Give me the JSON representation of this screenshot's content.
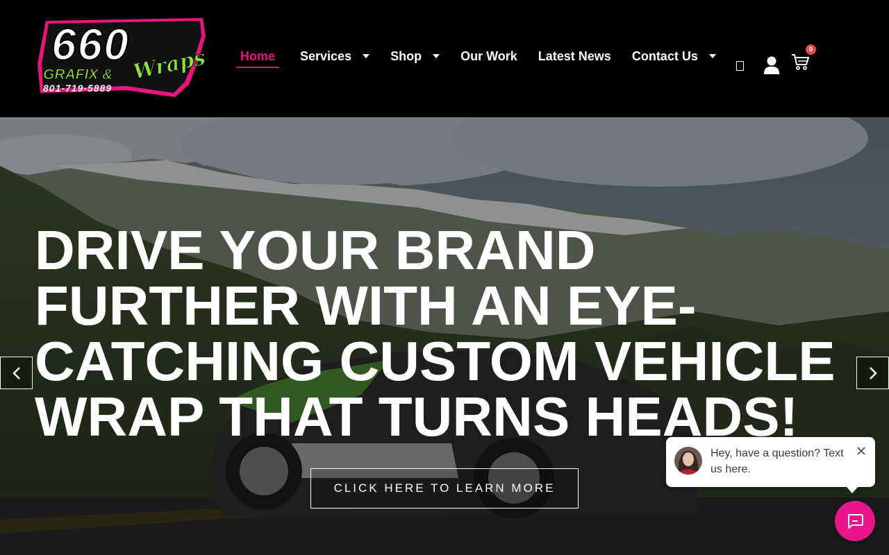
{
  "brand": {
    "logo_text": "660",
    "logo_sub1": "GRAFIX &",
    "logo_sub2": "Wraps",
    "logo_phone": "801-719-5889",
    "accent_color": "#e8157f",
    "green_color": "#8ee03c"
  },
  "nav": {
    "items": [
      {
        "label": "Home",
        "active": true,
        "dropdown": false
      },
      {
        "label": "Services",
        "active": false,
        "dropdown": true
      },
      {
        "label": "Shop",
        "active": false,
        "dropdown": true
      },
      {
        "label": "Our Work",
        "active": false,
        "dropdown": false
      },
      {
        "label": "Latest News",
        "active": false,
        "dropdown": false
      },
      {
        "label": "Contact Us",
        "active": false,
        "dropdown": true
      }
    ]
  },
  "header_icons": {
    "unknown_icon": "square-icon",
    "account_icon": "user-icon",
    "cart_icon": "cart-icon",
    "cart_count": "0"
  },
  "hero": {
    "title_lines": [
      "DRIVE YOUR BRAND",
      "FURTHER WITH AN EYE-",
      "CATCHING CUSTOM VEHICLE",
      "WRAP THAT TURNS HEADS!"
    ],
    "cta_label": "CLICK HERE TO LEARN MORE",
    "prev_icon": "chevron-left-icon",
    "next_icon": "chevron-right-icon"
  },
  "chat": {
    "message": "Hey, have a question? Text us here.",
    "close_icon": "close-icon",
    "launcher_icon": "chat-icon",
    "launcher_color": "#e8168d"
  }
}
